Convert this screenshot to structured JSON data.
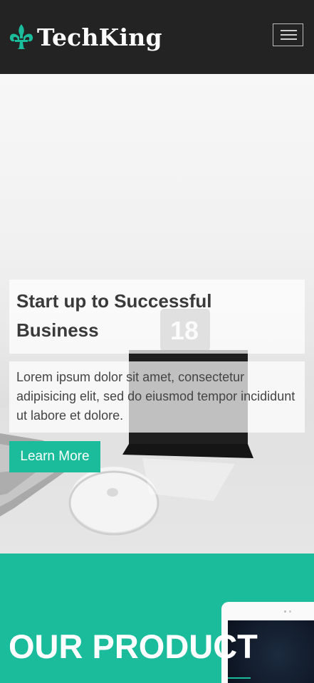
{
  "header": {
    "brand": "TechKing",
    "logo_icon": "fleur-de-lis-icon",
    "menu_icon": "hamburger-menu-icon",
    "accent_color": "#1abc9c",
    "background_color": "#232323"
  },
  "hero": {
    "title": "Start up to Successful Business",
    "text": "Lorem ipsum dolor sit amet, consectetur adipisicing elit, sed do eiusmod tempor incididunt ut labore et dolore.",
    "cta_label": "Learn More",
    "sign_number": "18"
  },
  "products": {
    "title": "OUR PRODUCT",
    "background_color": "#1abc9c"
  }
}
